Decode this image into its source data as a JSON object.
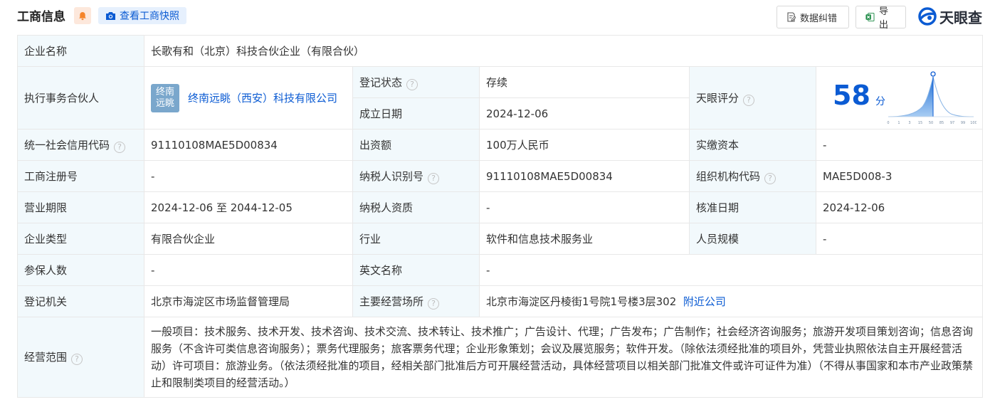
{
  "header": {
    "title": "工商信息",
    "snapshot_label": "查看工商快照",
    "correct_label": "数据纠错",
    "export_label": "导出",
    "brand": "天眼查"
  },
  "labels": {
    "company_name": "企业名称",
    "executive_partner": "执行事务合伙人",
    "reg_status": "登记状态",
    "established": "成立日期",
    "tianyan_score": "天眼评分",
    "credit_code": "统一社会信用代码",
    "capital_contrib": "出资额",
    "paid_capital": "实缴资本",
    "reg_number": "工商注册号",
    "taxpayer_id": "纳税人识别号",
    "org_code": "组织机构代码",
    "business_term": "营业期限",
    "taxpayer_qual": "纳税人资质",
    "approval_date": "核准日期",
    "company_type": "企业类型",
    "industry": "行业",
    "staff_size": "人员规模",
    "insured": "参保人数",
    "english_name": "英文名称",
    "reg_authority": "登记机关",
    "main_premises": "主要经营场所",
    "business_scope": "经营范围"
  },
  "values": {
    "company_name": "长歌有和（北京）科技合伙企业（有限合伙）",
    "executive_partner_logo": [
      "终南",
      "远眺"
    ],
    "executive_partner": "终南远眺（西安）科技有限公司",
    "reg_status": "存续",
    "established": "2024-12-06",
    "score": "58",
    "score_unit": "分",
    "credit_code": "91110108MAE5D00834",
    "capital_contrib": "100万人民币",
    "paid_capital": "-",
    "reg_number": "-",
    "taxpayer_id": "91110108MAE5D00834",
    "org_code": "MAE5D008-3",
    "business_term": "2024-12-06 至 2044-12-05",
    "taxpayer_qual": "-",
    "approval_date": "2024-12-06",
    "company_type": "有限合伙企业",
    "industry": "软件和信息技术服务业",
    "staff_size": "-",
    "insured": "-",
    "english_name": "-",
    "reg_authority": "北京市海淀区市场监督管理局",
    "main_premises": "北京市海淀区丹棱街1号院1号楼3层302",
    "nearby_link": "附近公司",
    "business_scope": "一般项目：技术服务、技术开发、技术咨询、技术交流、技术转让、技术推广；广告设计、代理；广告发布；广告制作；社会经济咨询服务；旅游开发项目策划咨询；信息咨询服务（不含许可类信息咨询服务）；票务代理服务；旅客票务代理；企业形象策划；会议及展览服务；软件开发。（除依法须经批准的项目外，凭营业执照依法自主开展经营活动）许可项目：旅游业务。（依法须经批准的项目，经相关部门批准后方可开展经营活动，具体经营项目以相关部门批准文件或许可证件为准）（不得从事国家和本市产业政策禁止和限制类项目的经营活动。）"
  },
  "score_chart": {
    "ticks": [
      "0",
      "1",
      "3",
      "15",
      "50",
      "85",
      "97",
      "99",
      "100"
    ],
    "marker": 58
  },
  "colors": {
    "accent": "#0b5bd3",
    "label_bg": "#f2f9fc",
    "status_green": "#16a34a",
    "logo_bg": "#7aa7cc"
  },
  "icons": {
    "bell": "bell-icon",
    "camera": "camera-icon",
    "correct": "document-edit-icon",
    "export": "excel-icon",
    "brand": "tianyancha-logo-icon",
    "hint": "question-circle-icon"
  }
}
